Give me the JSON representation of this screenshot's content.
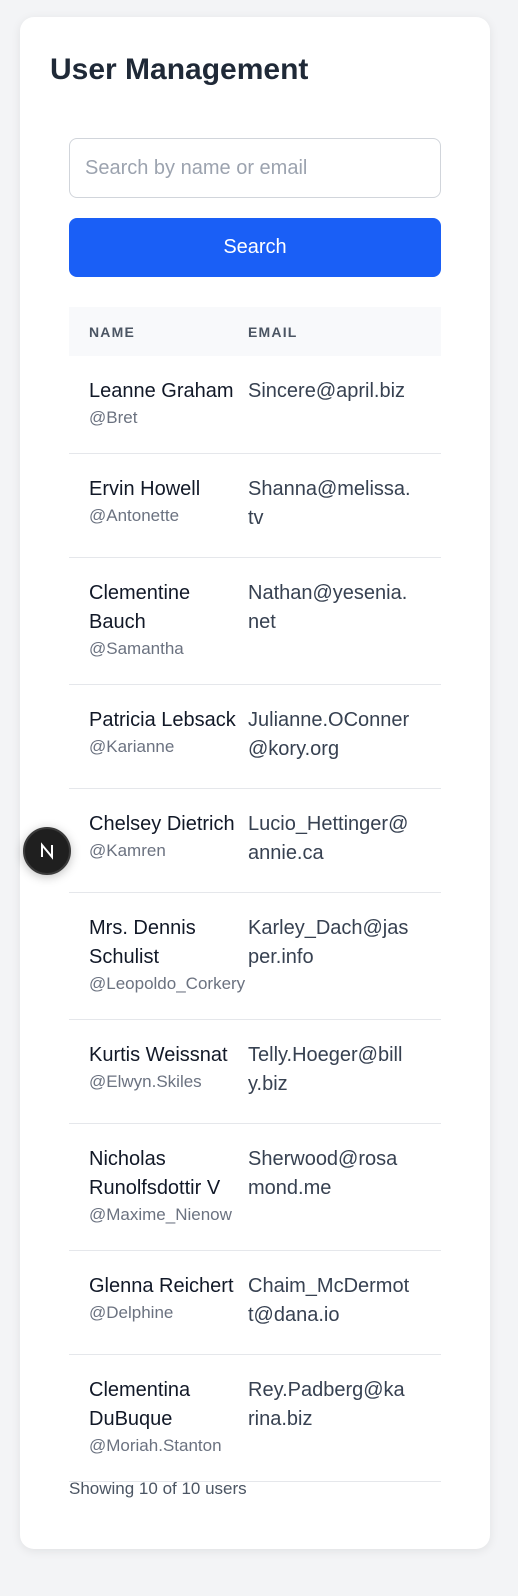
{
  "page": {
    "title": "User Management"
  },
  "search": {
    "placeholder": "Search by name or email",
    "value": "",
    "button_label": "Search"
  },
  "table": {
    "headers": {
      "name": "NAME",
      "email": "EMAIL"
    },
    "rows": [
      {
        "name": "Leanne Graham",
        "username": "@Bret",
        "email": "Sincere@april.biz"
      },
      {
        "name": "Ervin Howell",
        "username": "@Antonette",
        "email": "Shanna@melissa.tv"
      },
      {
        "name": "Clementine Bauch",
        "username": "@Samantha",
        "email": "Nathan@yesenia.net"
      },
      {
        "name": "Patricia Lebsack",
        "username": "@Karianne",
        "email": "Julianne.OConner@kory.org"
      },
      {
        "name": "Chelsey Dietrich",
        "username": "@Kamren",
        "email": "Lucio_Hettinger@annie.ca"
      },
      {
        "name": "Mrs. Dennis Schulist",
        "username": "@Leopoldo_Corkery",
        "email": "Karley_Dach@jasper.info"
      },
      {
        "name": "Kurtis Weissnat",
        "username": "@Elwyn.Skiles",
        "email": "Telly.Hoeger@billy.biz"
      },
      {
        "name": "Nicholas Runolfsdottir V",
        "username": "@Maxime_Nienow",
        "email": "Sherwood@rosamond.me"
      },
      {
        "name": "Glenna Reichert",
        "username": "@Delphine",
        "email": "Chaim_McDermott@dana.io"
      },
      {
        "name": "Clementina DuBuque",
        "username": "@Moriah.Stanton",
        "email": "Rey.Padberg@karina.biz"
      }
    ]
  },
  "footer": {
    "summary": "Showing 10 of 10 users"
  },
  "dev_badge": {
    "icon": "nextjs-logo-icon"
  },
  "colors": {
    "accent": "#1a5ff6",
    "title": "#1f2937",
    "muted": "#6b7280",
    "header_bg": "#f8f9fb"
  }
}
